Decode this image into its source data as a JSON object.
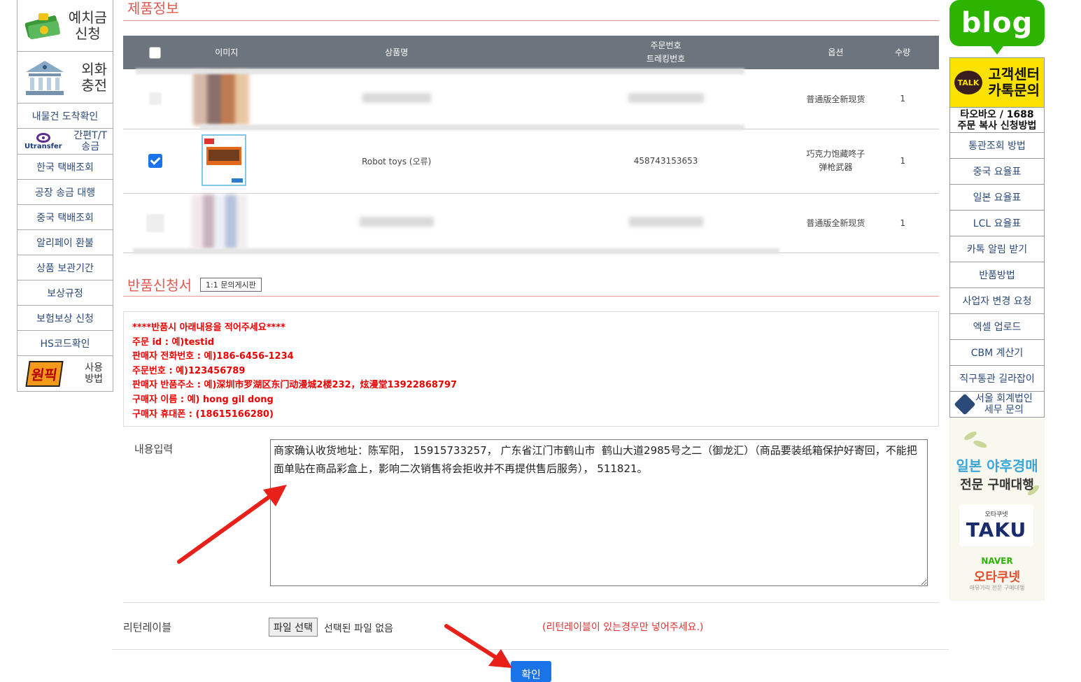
{
  "left_sidebar": {
    "deposit": "예치금\n신청",
    "forex": "외화\n충전",
    "items": [
      "내물건 도착확인",
      "한국 택배조회",
      "공장 송금 대행",
      "중국 택배조회",
      "알리페이 환불",
      "상품 보관기간",
      "보상규정",
      "보험보상 신청",
      "HS코드확인"
    ],
    "utransfer_logo": "Utransfer",
    "utransfer_label": "간편T/T\n송금",
    "onepick_logo": "원픽",
    "onepick_label": "사용\n방법"
  },
  "right_sidebar": {
    "blog": "blog",
    "talk": "TALK",
    "kakao_text": "고객센터\n카톡문의",
    "taobao_text": "타오바오 / 1688\n주문 복사 신청방법",
    "items": [
      "통관조회 방법",
      "중국 요율표",
      "일본 요율표",
      "LCL 요율표",
      "카톡 알림 받기",
      "반품방법",
      "사업자 변경 요청",
      "엑셀 업로드",
      "CBM 계산기",
      "직구통관 길라잡이"
    ],
    "seoul_text": "서울 회계법인\n세무 문의",
    "yahoo_title": "일본 야후경매",
    "yahoo_sub": "전문 구매대행",
    "taku_small": "오타쿠넷",
    "taku_logo": "TAKU",
    "naver": "NAVER",
    "otaku": "오타쿠넷",
    "otaku_sub": "애뮤가리 전문 구매대행"
  },
  "product_section": {
    "title": "제품정보",
    "headers": {
      "image": "이미지",
      "name": "상품명",
      "order_no": "주문번호",
      "tracking_no": "트레킹번호",
      "option": "옵션",
      "qty": "수량"
    },
    "rows": [
      {
        "name": "",
        "order": "",
        "option": "普通版全新现货",
        "qty": "1",
        "checked": false
      },
      {
        "name": "Robot toys (오류)",
        "order": "458743153653",
        "option": "巧克力饱藏咚子\n弹枪武器",
        "qty": "1",
        "checked": true
      },
      {
        "name": "",
        "order": "",
        "option": "普通版全新现货",
        "qty": "1",
        "checked": false
      }
    ]
  },
  "return_section": {
    "title": "반품신청서",
    "qa_button": "1:1 문의게시판",
    "notice": [
      "****반품시 아래내용을 적어주세요****",
      "주문 id : 예)testid",
      "판매자 전화번호 : 예)186-6456-1234",
      "주문번호 : 예)123456789",
      "판매자 반품주소 : 예)深圳市罗湖区东门动漫城2楼232，炫漫堂13922868797",
      "구매자 이름 : 예) hong gil dong",
      "구매자 휴대폰 : (18615166280)"
    ],
    "content_label": "내용입력",
    "content_value": "商家确认收货地址：陈军阳， 15915733257， 广东省江门市鹤山市  鹤山大道2985号之二（御龙汇）（商品要装纸箱保护好寄回，不能把面单贴在商品彩盒上，影响二次销售将会拒收并不再提供售后服务）， 511821。",
    "return_label": "리턴레이블",
    "file_button": "파일 선택",
    "file_none": "선택된 파일 없음",
    "label_hint": "(리턴레이블이 있는경우만 넣어주세요.)",
    "confirm": "확인"
  },
  "colors": {
    "accent_red": "#e05a4f",
    "header_gray": "#6c757d",
    "primary_blue": "#1a73e8",
    "arrow_red": "#e8201a"
  }
}
